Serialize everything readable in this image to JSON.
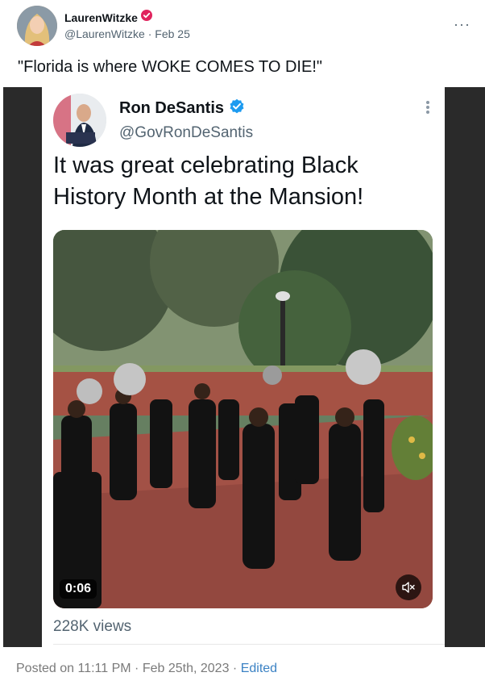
{
  "post": {
    "author_name": "LaurenWitzke",
    "handle": "@LaurenWitzke",
    "separator": "·",
    "date": "Feb 25",
    "text": "\"Florida is where WOKE COMES TO DIE!\"",
    "more_icon": "more-dots-icon",
    "verified_icon": "verified-badge-icon",
    "verified_color": "#e0245e"
  },
  "embedded_tweet": {
    "author_name": "Ron DeSantis",
    "handle": "@GovRonDeSantis",
    "verified_color": "#1d9bf0",
    "text": "It was great celebrating Black History Month at the Mansion!",
    "video": {
      "timecode": "0:06",
      "mute_icon": "speaker-muted-icon"
    },
    "views": "228K views"
  },
  "footer": {
    "posted_label": "Posted on 11:11 PM · Feb 25th, 2023 ·",
    "edited_label": "Edited",
    "link_color": "#3b82c4"
  }
}
